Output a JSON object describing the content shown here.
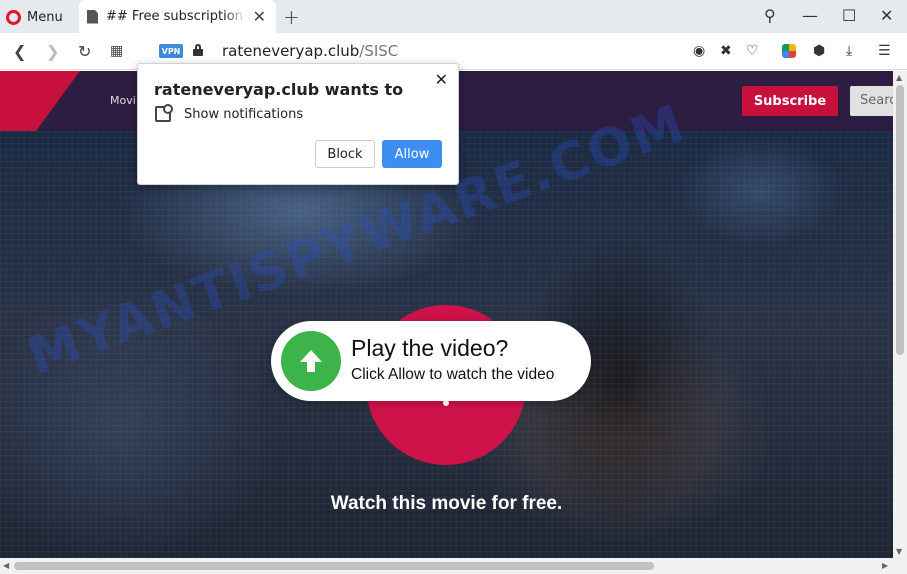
{
  "browser": {
    "menu_label": "Menu",
    "tab_title": "## Free subscription",
    "tab_close": "✕",
    "new_tab": "+",
    "window_controls": {
      "search": "⚲",
      "minimize": "—",
      "maximize": "☐",
      "close": "✕"
    }
  },
  "address_bar": {
    "vpn_label": "VPN",
    "url_domain": "rateneveryap.club",
    "url_path": "/SISC",
    "icons": [
      "camera-icon",
      "block-ads-icon",
      "heart-icon",
      "wallet-icon",
      "cube-icon",
      "download-icon",
      "settings-icon"
    ]
  },
  "site": {
    "nav_item": "Movi",
    "subscribe_label": "Subscribe",
    "search_placeholder": "Searc",
    "play_title": "Play the video?",
    "play_subtitle": "Click Allow to watch the video",
    "watch_text": "Watch this movie for free.",
    "watermark": "MYANTISPYWARE.COM"
  },
  "notification": {
    "title": "rateneveryap.club wants to",
    "permission": "Show notifications",
    "block_label": "Block",
    "allow_label": "Allow",
    "close": "✕"
  },
  "colors": {
    "accent": "#c8103c",
    "allow_button": "#3d8ef0",
    "play_arrow_green": "#3cb44a"
  }
}
